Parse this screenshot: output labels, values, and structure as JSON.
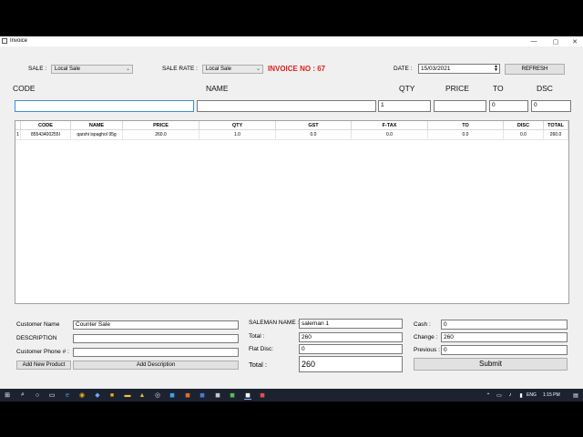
{
  "window": {
    "title": "Invoice",
    "min": "—",
    "max": "▢",
    "close": "✕"
  },
  "top": {
    "sale_label": "SALE :",
    "sale_value": "Local Sale",
    "sale_rate_label": "SALE RATE :",
    "sale_rate_value": "Local Sale",
    "invoice_label": "INVOICE NO : 67",
    "date_label": "DATE :",
    "date_value": "15/03/2021",
    "refresh_label": "REFRESH"
  },
  "entry": {
    "code_label": "CODE",
    "name_label": "NAME",
    "qty_label": "QTY",
    "price_label": "PRICE",
    "to_label": "TO",
    "dsc_label": "DSC",
    "code_value": "",
    "name_value": "",
    "qty_value": "1",
    "price_value": "",
    "to_value": "0",
    "dsc_value": "0"
  },
  "table": {
    "headers": [
      "CODE",
      "NAME",
      "PRICE",
      "QTY",
      "GST",
      "F-TAX",
      "TO",
      "DISC",
      "TOTAL"
    ],
    "row_index": "1",
    "row": [
      "85543400255I",
      "qarshi ispaghol 95g",
      "260.0",
      "1.0",
      "0.0",
      "0.0",
      "0.0",
      "0.0",
      "260.0"
    ]
  },
  "customer": {
    "name_label": "Customer Name",
    "name_value": "Counter Sale",
    "desc_label": "DESCRIPTION",
    "desc_value": "",
    "phone_label": "Customer Phone # :",
    "phone_value": "",
    "add_product": "Add New Product",
    "add_desc": "Add Description"
  },
  "sale": {
    "saleman_label": "SALEMAN NAME :",
    "saleman_value": "saleman 1",
    "total_label": "Total :",
    "total_value": "260",
    "flat_label": "Flat Disc:",
    "flat_value": "0",
    "big_total_label": "Total :",
    "big_total_value": "260"
  },
  "payment": {
    "cash_label": "Cash :",
    "cash_value": "0",
    "change_label": "Change :",
    "change_value": "260",
    "previous_label": "Previous :",
    "previous_value": "0",
    "submit": "Submit"
  },
  "taskbar": {
    "lang": "ENG",
    "time": "1:15 PM"
  },
  "colors": {
    "invoice_red": "#e0201a",
    "window_bg": "#f0f0f0",
    "taskbar": "#1c2230"
  }
}
